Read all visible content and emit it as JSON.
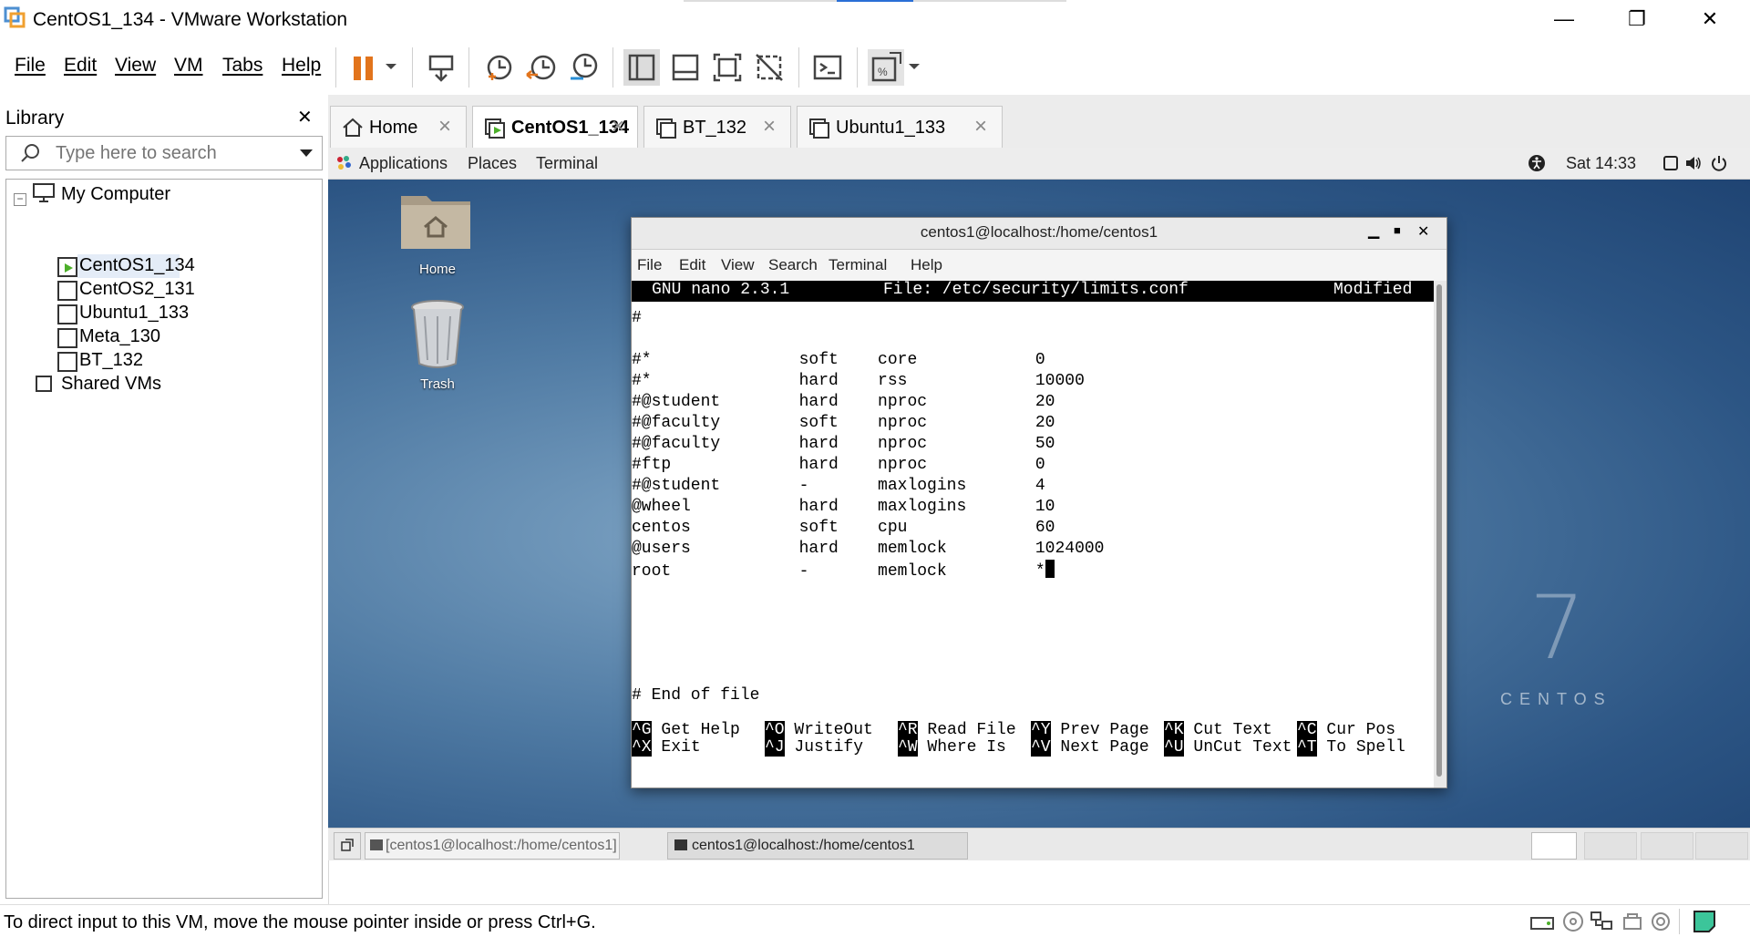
{
  "window": {
    "title": "CentOS1_134 - VMware Workstation"
  },
  "menu": {
    "file": "File",
    "edit": "Edit",
    "view": "View",
    "vm": "VM",
    "tabs": "Tabs",
    "help": "Help"
  },
  "library": {
    "title": "Library",
    "search_placeholder": "Type here to search",
    "tree": {
      "my_computer": "My Computer",
      "vms": [
        "CentOS1_134",
        "CentOS2_131",
        "Ubuntu1_133",
        "Meta_130",
        "BT_132"
      ],
      "shared": "Shared VMs"
    }
  },
  "tabs": [
    {
      "label": "Home"
    },
    {
      "label": "CentOS1_134"
    },
    {
      "label": "BT_132"
    },
    {
      "label": "Ubuntu1_133"
    }
  ],
  "gnome": {
    "applications": "Applications",
    "places": "Places",
    "terminal": "Terminal",
    "clock": "Sat 14:33"
  },
  "desktop": {
    "home_label": "Home",
    "trash_label": "Trash",
    "brand_number": "7",
    "brand_text": "CENTOS"
  },
  "terminal": {
    "title": "centos1@localhost:/home/centos1",
    "menu": [
      "File",
      "Edit",
      "View",
      "Search",
      "Terminal",
      "Help"
    ],
    "nano_version": "GNU nano 2.3.1",
    "file": "File: /etc/security/limits.conf",
    "status": "Modified",
    "lines": [
      "#",
      "",
      "#*               soft    core            0",
      "#*               hard    rss             10000",
      "#@student        hard    nproc           20",
      "#@faculty        soft    nproc           20",
      "#@faculty        hard    nproc           50",
      "#ftp             hard    nproc           0",
      "#@student        -       maxlogins       4",
      "@wheel           hard    maxlogins       10",
      "centos           soft    cpu             60",
      "@users           hard    memlock         1024000",
      "root             -       memlock         *"
    ],
    "end_line": "# End of file",
    "shortcuts_row1": [
      {
        "key": "^G",
        "label": " Get Help  "
      },
      {
        "key": "^O",
        "label": " WriteOut  "
      },
      {
        "key": "^R",
        "label": " Read File "
      },
      {
        "key": "^Y",
        "label": " Prev Page "
      },
      {
        "key": "^K",
        "label": " Cut Text  "
      },
      {
        "key": "^C",
        "label": " Cur Pos"
      }
    ],
    "shortcuts_row2": [
      {
        "key": "^X",
        "label": " Exit      "
      },
      {
        "key": "^J",
        "label": " Justify   "
      },
      {
        "key": "^W",
        "label": " Where Is  "
      },
      {
        "key": "^V",
        "label": " Next Page "
      },
      {
        "key": "^U",
        "label": " UnCut Text"
      },
      {
        "key": "^T",
        "label": " To Spell"
      }
    ]
  },
  "taskbar": {
    "item1": "[centos1@localhost:/home/centos1]",
    "item2": "centos1@localhost:/home/centos1"
  },
  "status": {
    "message": "To direct input to this VM, move the mouse pointer inside or press Ctrl+G."
  }
}
